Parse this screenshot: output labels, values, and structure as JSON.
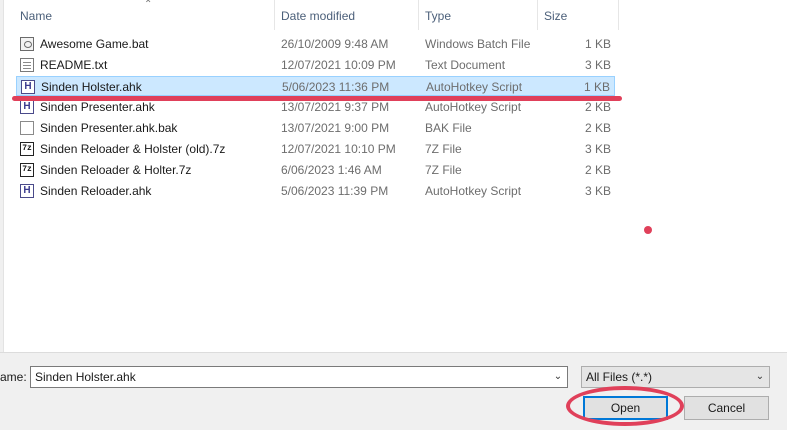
{
  "header": {
    "columns": [
      {
        "label": "Name"
      },
      {
        "label": "Date modified"
      },
      {
        "label": "Type"
      },
      {
        "label": "Size"
      }
    ]
  },
  "files": [
    {
      "name": "Awesome Game.bat",
      "date": "26/10/2009 9:48 AM",
      "type": "Windows Batch File",
      "size": "1 KB",
      "icon": "batch-file-icon"
    },
    {
      "name": "README.txt",
      "date": "12/07/2021 10:09 PM",
      "type": "Text Document",
      "size": "3 KB",
      "icon": "text-file-icon"
    },
    {
      "name": "Sinden Holster.ahk",
      "date": "5/06/2023 11:36 PM",
      "type": "AutoHotkey Script",
      "size": "1 KB",
      "icon": "autohotkey-file-icon",
      "selected": true
    },
    {
      "name": "Sinden Presenter.ahk",
      "date": "13/07/2021 9:37 PM",
      "type": "AutoHotkey Script",
      "size": "2 KB",
      "icon": "autohotkey-file-icon"
    },
    {
      "name": "Sinden Presenter.ahk.bak",
      "date": "13/07/2021 9:00 PM",
      "type": "BAK File",
      "size": "2 KB",
      "icon": "generic-file-icon"
    },
    {
      "name": "Sinden Reloader & Holster (old).7z",
      "date": "12/07/2021 10:10 PM",
      "type": "7Z File",
      "size": "3 KB",
      "icon": "7z-archive-icon"
    },
    {
      "name": "Sinden Reloader & Holter.7z",
      "date": "6/06/2023 1:46 AM",
      "type": "7Z File",
      "size": "2 KB",
      "icon": "7z-archive-icon"
    },
    {
      "name": "Sinden Reloader.ahk",
      "date": "5/06/2023 11:39 PM",
      "type": "AutoHotkey Script",
      "size": "3 KB",
      "icon": "autohotkey-file-icon"
    }
  ],
  "footer": {
    "filename_label": "ame:",
    "filename_value": "Sinden Holster.ahk",
    "filter_value": "All Files (*.*)",
    "open_label": "Open",
    "cancel_label": "Cancel"
  },
  "colors": {
    "selection": "#cce8ff",
    "annotation_red": "#e0405a",
    "accent": "#0078d7"
  }
}
